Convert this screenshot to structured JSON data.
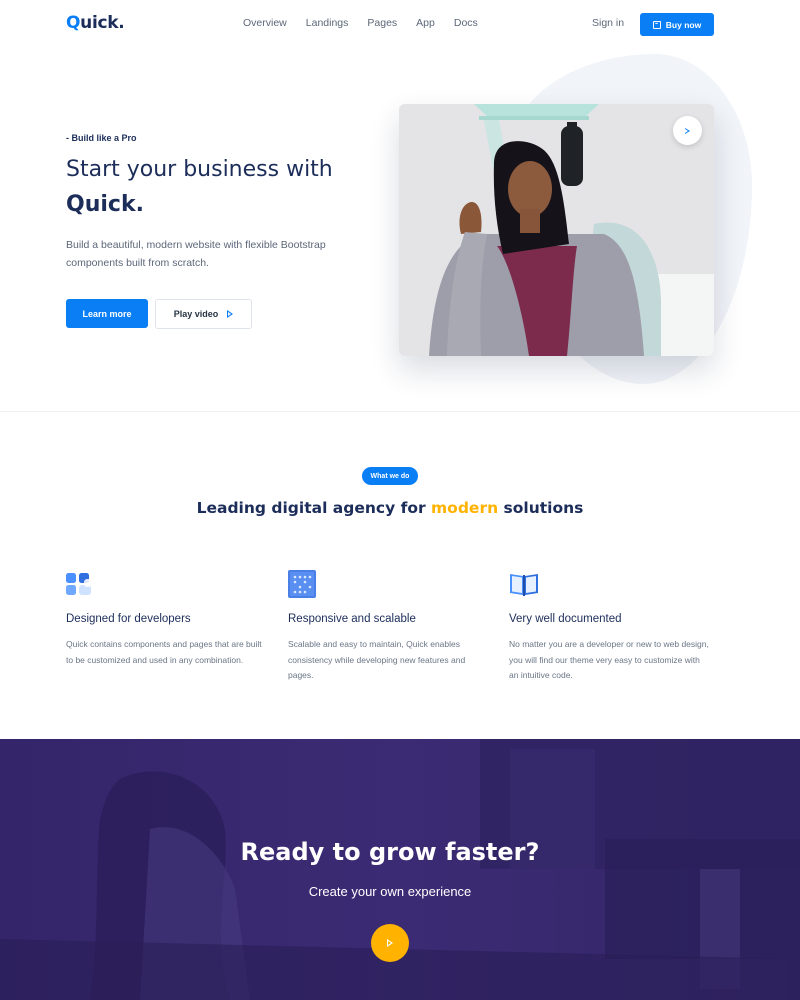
{
  "brand": {
    "name": "Quick.",
    "accent": "#0a7ef5",
    "dark": "#1c2d5a",
    "highlight": "#ffb300"
  },
  "nav": {
    "links": [
      "Overview",
      "Landings",
      "Pages",
      "App",
      "Docs"
    ],
    "signin": "Sign in",
    "buy": "Buy now",
    "buy_icon": "shopping-bag-icon"
  },
  "hero": {
    "eyebrow": "- Build like a Pro",
    "title_line1": "Start your business with",
    "title_line2": "Quick.",
    "description": "Build a beautiful, modern website with flexible Bootstrap components built from scratch.",
    "primary_button": "Learn more",
    "secondary_button": "Play video",
    "play_icon": "play-icon"
  },
  "whatwedo": {
    "badge": "What we do",
    "title_before": "Leading digital agency for",
    "title_highlight": "modern",
    "title_after": "solutions",
    "features": [
      {
        "icon": "blocks-icon",
        "title": "Designed for developers",
        "text": "Quick contains components and pages that are built to be customized and used in any combination."
      },
      {
        "icon": "grid-panel-icon",
        "title": "Responsive and scalable",
        "text": "Scalable and easy to maintain, Quick enables consistency while developing new features and pages."
      },
      {
        "icon": "book-icon",
        "title": "Very well documented",
        "text": "No matter you are a developer or new to web design, you will find our theme very easy to customize with an intuitive code."
      }
    ]
  },
  "cta": {
    "title": "Ready to grow faster?",
    "subtitle": "Create your own experience",
    "play_icon": "play-icon"
  }
}
